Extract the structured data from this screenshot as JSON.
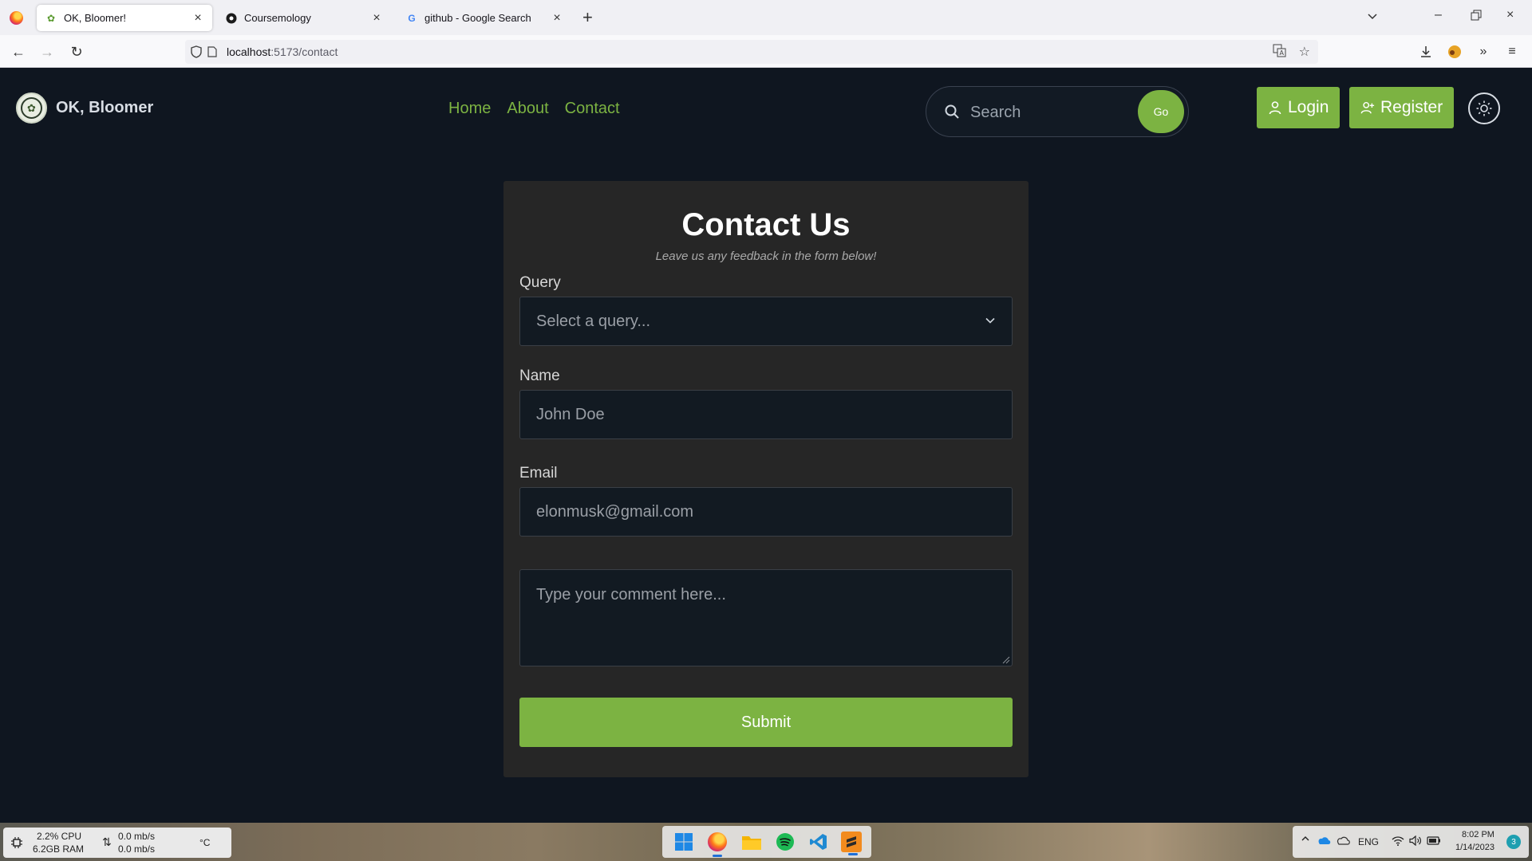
{
  "browser": {
    "tabs": [
      {
        "title": "OK, Bloomer!",
        "active": true
      },
      {
        "title": "Coursemology",
        "active": false
      },
      {
        "title": "github - Google Search",
        "active": false
      }
    ],
    "url_host": "localhost",
    "url_path": ":5173/contact"
  },
  "site": {
    "brand": "OK, Bloomer",
    "nav": [
      "Home",
      "About",
      "Contact"
    ],
    "search_placeholder": "Search",
    "go_label": "Go",
    "login_label": "Login",
    "register_label": "Register"
  },
  "form": {
    "title": "Contact Us",
    "subtitle": "Leave us any feedback in the form below!",
    "query_label": "Query",
    "query_value": "Select a query...",
    "name_label": "Name",
    "name_placeholder": "John Doe",
    "email_label": "Email",
    "email_placeholder": "elonmusk@gmail.com",
    "comment_placeholder": "Type your comment here...",
    "submit_label": "Submit"
  },
  "taskbar": {
    "cpu": "2.2% CPU",
    "ram": "6.2GB RAM",
    "net_up": "0.0 mb/s",
    "net_down": "0.0 mb/s",
    "temp": "°C",
    "lang": "ENG",
    "time": "8:02 PM",
    "date": "1/14/2023",
    "notifications": "3"
  },
  "colors": {
    "accent": "#7cb342",
    "page_bg": "#0f1620",
    "card_bg": "#262626"
  }
}
